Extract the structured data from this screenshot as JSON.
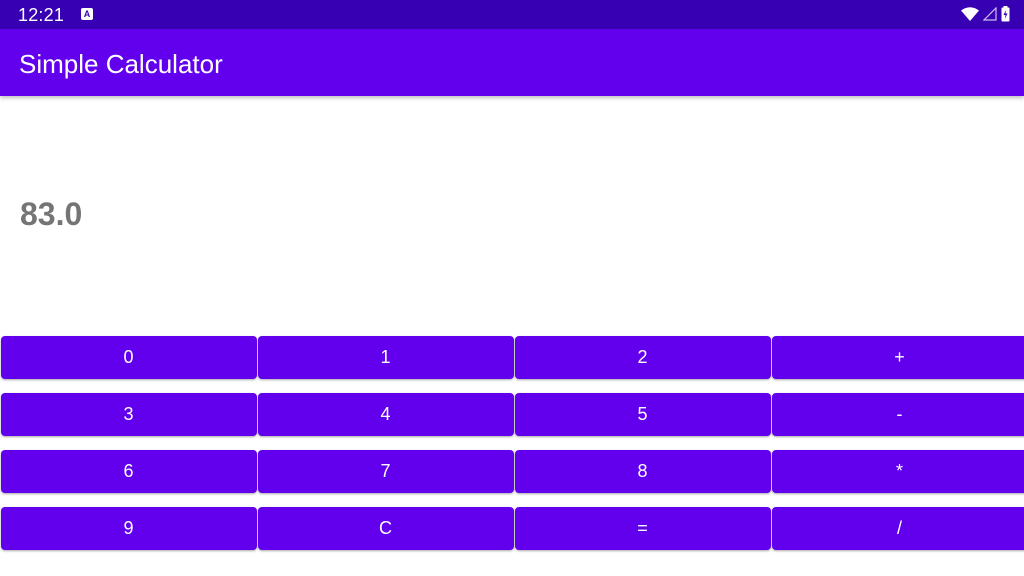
{
  "status_bar": {
    "time": "12:21",
    "notification_icon_label": "A",
    "icons": [
      "wifi-icon",
      "signal-icon",
      "battery-charging-icon"
    ]
  },
  "app_bar": {
    "title": "Simple Calculator"
  },
  "display": {
    "value": "83.0"
  },
  "keypad": {
    "rows": [
      [
        "0",
        "1",
        "2",
        "+"
      ],
      [
        "3",
        "4",
        "5",
        "-"
      ],
      [
        "6",
        "7",
        "8",
        "*"
      ],
      [
        "9",
        "C",
        "=",
        "/"
      ]
    ]
  },
  "colors": {
    "status_bar": "#3700b3",
    "primary": "#6200ee",
    "display_text": "#757575",
    "button_text": "#ffffff"
  }
}
